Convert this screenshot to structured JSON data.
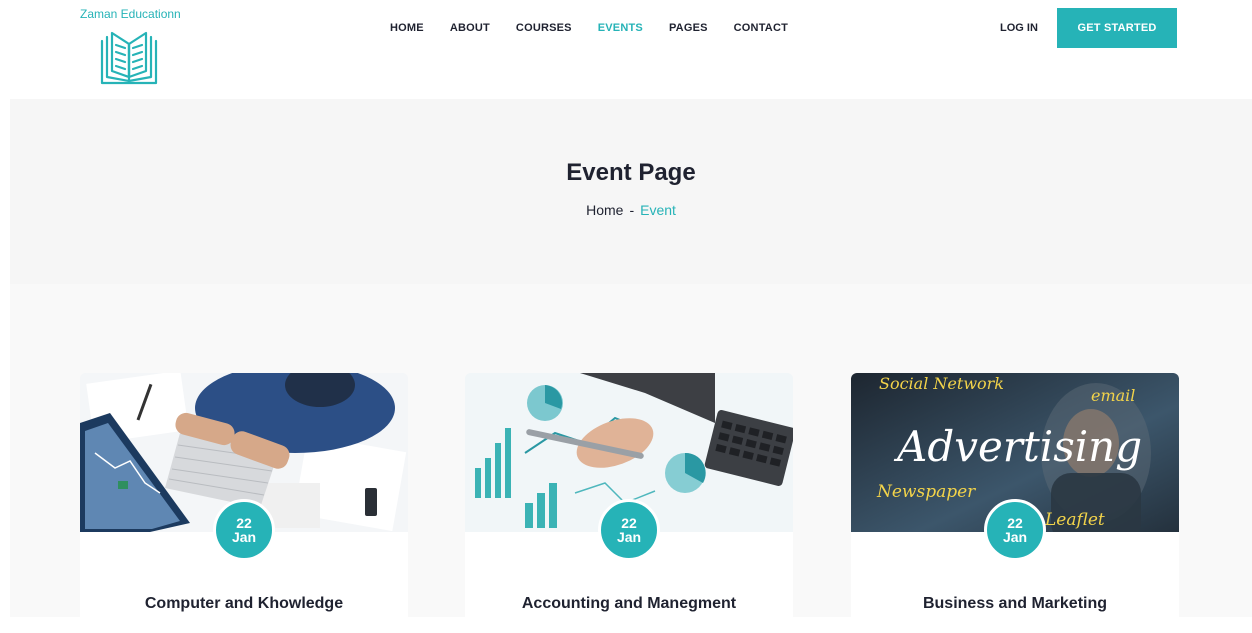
{
  "brand": {
    "name": "Zaman Educationn",
    "icon": "open-book-icon",
    "accent": "#26b3b7"
  },
  "nav": {
    "items": [
      {
        "label": "HOME"
      },
      {
        "label": "ABOUT"
      },
      {
        "label": "COURSES"
      },
      {
        "label": "EVENTS",
        "active": true
      },
      {
        "label": "PAGES"
      },
      {
        "label": "CONTACT"
      }
    ],
    "login_label": "LOG IN",
    "cta_label": "GET STARTED"
  },
  "hero": {
    "title": "Event Page",
    "breadcrumb": {
      "home": "Home",
      "separator": "-",
      "current": "Event"
    }
  },
  "events": [
    {
      "day": "22",
      "month": "Jan",
      "title": "Computer and Khowledge"
    },
    {
      "day": "22",
      "month": "Jan",
      "title": "Accounting and Manegment"
    },
    {
      "day": "22",
      "month": "Jan",
      "title": "Business and Marketing",
      "image_words": {
        "w1": "Social Network",
        "w2": "email",
        "w3": "Advertising",
        "w4": "Newspaper",
        "w5": "Leaflet"
      }
    }
  ]
}
